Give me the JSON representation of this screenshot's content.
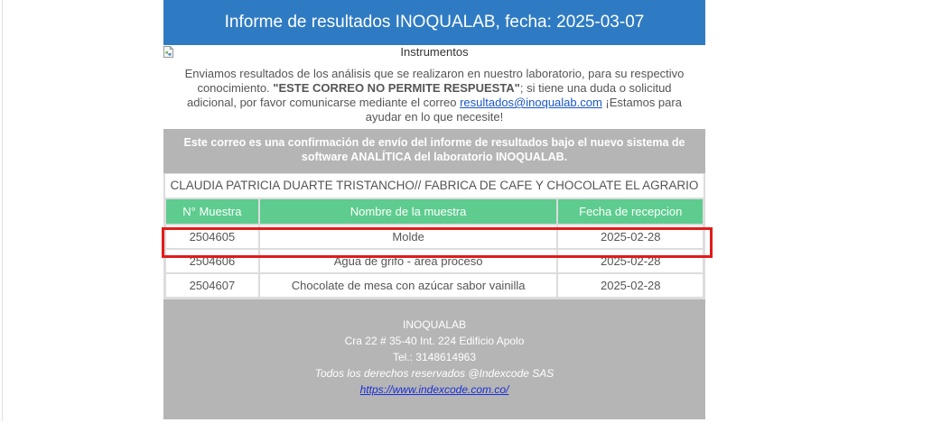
{
  "header": {
    "title": "Informe de resultados INOQUALAB, fecha: 2025-03-07"
  },
  "image": {
    "alt_text": "Instrumentos"
  },
  "intro": {
    "text_before_bold": "Enviamos resultados de los análisis que se realizaron en nuestro laboratorio, para su respectivo conocimiento. ",
    "bold_text": "\"ESTE CORREO NO PERMITE RESPUESTA\"",
    "text_after_bold": "; si tiene una duda o solicitud adicional, por favor comunicarse mediante el correo ",
    "email_link": "resultados@inoqualab.com",
    "text_end": " ¡Estamos para ayudar en lo que necesite!"
  },
  "notice": {
    "text": "Este correo es una confirmación de envío del informe de resultados bajo el nuevo sistema de software ANALÍTICA del laboratorio INOQUALAB."
  },
  "client": {
    "text": "CLAUDIA PATRICIA DUARTE TRISTANCHO// FABRICA DE CAFE Y CHOCOLATE EL AGRARIO"
  },
  "table": {
    "headers": [
      "N° Muestra",
      "Nombre de la muestra",
      "Fecha de recepcion"
    ],
    "rows": [
      [
        "2504605",
        "Molde",
        "2025-02-28"
      ],
      [
        "2504606",
        "Agua de grifo - área proceso",
        "2025-02-28"
      ],
      [
        "2504607",
        "Chocolate de mesa con azúcar sabor vainilla",
        "2025-02-28"
      ]
    ]
  },
  "footer": {
    "company": "INOQUALAB",
    "address": "Cra 22 # 35-40 Int. 224 Edificio Apolo",
    "phone": "Tel.: 3148614963",
    "copyright": "Todos los derechos reservados @Indexcode SAS",
    "link": "https://www.indexcode.com.co/"
  },
  "colors": {
    "banner": "#2f7bc3",
    "notice_bg": "#b5b5b5",
    "table_header": "#5dcc8e",
    "highlight": "#e21b1b"
  },
  "icons": {
    "broken_image": "broken-image-icon"
  }
}
